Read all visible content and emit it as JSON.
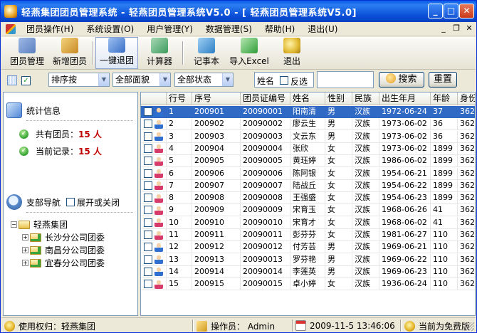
{
  "window": {
    "title": "轻燕集团团员管理系统 -  轻燕团员管理系统V5.0 - [ 轻燕团员管理系统V5.0]",
    "controls": {
      "minimize": "_",
      "maximize": "□",
      "close": "✕"
    },
    "mdi_controls": {
      "minimize": "_",
      "restore": "❐",
      "close": "✕"
    }
  },
  "menu": [
    {
      "label": "团员操作(H)"
    },
    {
      "label": "系统设置(O)"
    },
    {
      "label": "用户管理(Y)"
    },
    {
      "label": "数据管理(S)"
    },
    {
      "label": "帮助(H)"
    },
    {
      "label": "退出(U)"
    }
  ],
  "toolbar": [
    {
      "label": "团员管理",
      "icon": "member-manage-icon",
      "color": "#6d8fc6"
    },
    {
      "label": "新增团员",
      "icon": "add-member-icon",
      "color": "#d9a73a"
    },
    {
      "label": "一键退团",
      "icon": "quit-league-icon",
      "color": "#4a7fd0"
    },
    {
      "label": "计算器",
      "icon": "calculator-icon",
      "color": "#3c9a5c"
    },
    {
      "label": "记事本",
      "icon": "notepad-icon",
      "color": "#3b8fd4"
    },
    {
      "label": "导入Excel",
      "icon": "excel-import-icon",
      "color": "#2f9e3a"
    },
    {
      "label": "退出",
      "icon": "exit-icon",
      "color": "#e0b830"
    }
  ],
  "filter": {
    "sort": "排序按",
    "face": "全部面貌",
    "state": "全部状态",
    "name_select": "姓名",
    "invert_label": "反选",
    "search_label": "搜索",
    "reset_label": "重置",
    "search_value": ""
  },
  "left": {
    "stats_title": "统计信息",
    "total_label": "共有团员：",
    "total_value": "15 人",
    "current_label": "当前记录：",
    "current_value": "15 人",
    "branch_title": "支部导航",
    "expand_label": "展开或关闭",
    "tree": {
      "root": "轻燕集团",
      "children": [
        "长沙分公司团委",
        "南昌分公司团委",
        "宜春分公司团委"
      ]
    }
  },
  "grid": {
    "columns": [
      "",
      "行号",
      "序号",
      "团员证编号",
      "姓名",
      "性别",
      "民族",
      "出生年月",
      "年龄",
      "身份"
    ],
    "rows": [
      {
        "row": "1",
        "seq": "200901",
        "card": "20090001",
        "name": "阳南清",
        "sex": "男",
        "ethnic": "汉族",
        "birth": "1972-06-24",
        "age": "37",
        "id": "362",
        "gender": "m"
      },
      {
        "row": "2",
        "seq": "200902",
        "card": "20090002",
        "name": "廖云生",
        "sex": "男",
        "ethnic": "汉族",
        "birth": "1973-06-02",
        "age": "36",
        "id": "362",
        "gender": "m"
      },
      {
        "row": "3",
        "seq": "200903",
        "card": "20090003",
        "name": "文云东",
        "sex": "男",
        "ethnic": "汉族",
        "birth": "1973-06-02",
        "age": "36",
        "id": "362",
        "gender": "m"
      },
      {
        "row": "4",
        "seq": "200904",
        "card": "20090004",
        "name": "张欣",
        "sex": "女",
        "ethnic": "汉族",
        "birth": "1973-06-02",
        "age": "1899",
        "id": "362",
        "gender": "f"
      },
      {
        "row": "5",
        "seq": "200905",
        "card": "20090005",
        "name": "黄珏婷",
        "sex": "女",
        "ethnic": "汉族",
        "birth": "1986-06-02",
        "age": "1899",
        "id": "362",
        "gender": "f"
      },
      {
        "row": "6",
        "seq": "200906",
        "card": "20090006",
        "name": "陈阿银",
        "sex": "女",
        "ethnic": "汉族",
        "birth": "1954-06-21",
        "age": "1899",
        "id": "362",
        "gender": "f"
      },
      {
        "row": "7",
        "seq": "200907",
        "card": "20090007",
        "name": "陆战丘",
        "sex": "女",
        "ethnic": "汉族",
        "birth": "1954-06-22",
        "age": "1899",
        "id": "362",
        "gender": "f"
      },
      {
        "row": "8",
        "seq": "200908",
        "card": "20090008",
        "name": "王强盛",
        "sex": "女",
        "ethnic": "汉族",
        "birth": "1954-06-23",
        "age": "1899",
        "id": "362",
        "gender": "f"
      },
      {
        "row": "9",
        "seq": "200909",
        "card": "20090009",
        "name": "宋育玉",
        "sex": "女",
        "ethnic": "汉族",
        "birth": "1968-06-26",
        "age": "41",
        "id": "362",
        "gender": "f"
      },
      {
        "row": "10",
        "seq": "200910",
        "card": "20090010",
        "name": "宋育才",
        "sex": "女",
        "ethnic": "汉族",
        "birth": "1968-06-02",
        "age": "41",
        "id": "362",
        "gender": "f"
      },
      {
        "row": "11",
        "seq": "200911",
        "card": "20090011",
        "name": "彭芬芬",
        "sex": "女",
        "ethnic": "汉族",
        "birth": "1981-06-27",
        "age": "110",
        "id": "362",
        "gender": "f"
      },
      {
        "row": "12",
        "seq": "200912",
        "card": "20090012",
        "name": "付芳芸",
        "sex": "男",
        "ethnic": "汉族",
        "birth": "1969-06-21",
        "age": "110",
        "id": "362",
        "gender": "m"
      },
      {
        "row": "13",
        "seq": "200913",
        "card": "20090013",
        "name": "罗芬艳",
        "sex": "男",
        "ethnic": "汉族",
        "birth": "1969-06-22",
        "age": "110",
        "id": "362",
        "gender": "m"
      },
      {
        "row": "14",
        "seq": "200914",
        "card": "20090014",
        "name": "李莲英",
        "sex": "男",
        "ethnic": "汉族",
        "birth": "1969-06-23",
        "age": "110",
        "id": "362",
        "gender": "m"
      },
      {
        "row": "15",
        "seq": "200915",
        "card": "20090015",
        "name": "卓小婷",
        "sex": "女",
        "ethnic": "汉族",
        "birth": "1936-06-24",
        "age": "110",
        "id": "362",
        "gender": "f"
      }
    ]
  },
  "status": {
    "owner": "使用权归：轻燕集团",
    "operator": "操作员：  Admin",
    "datetime": "2009-11-5 13:46:06",
    "license": "当前为免费版"
  },
  "colors": {
    "title_bar": "#0a5ce8",
    "selection": "#316ac5",
    "red_value": "#c00000"
  }
}
